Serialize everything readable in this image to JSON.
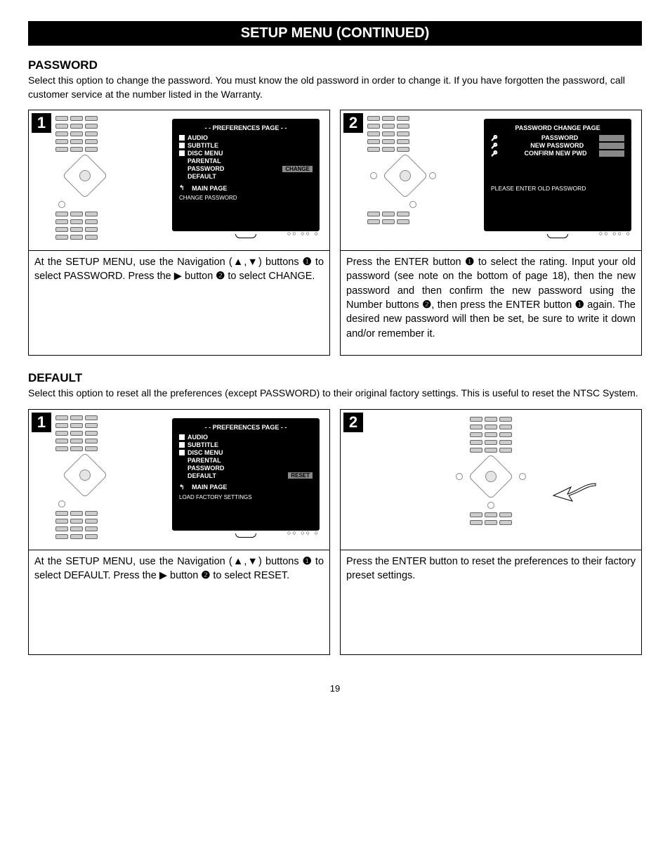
{
  "header": {
    "title": "SETUP MENU (CONTINUED)"
  },
  "sections": {
    "password": {
      "heading": "PASSWORD",
      "desc": "Select this option to change the password. You must know the old password in order to change it. If you have forgotten the password, call customer service at the number listed in the Warranty.",
      "step1": {
        "num": "1",
        "tv": {
          "title": "- - PREFERENCES PAGE - -",
          "items": [
            "AUDIO",
            "SUBTITLE",
            "DISC MENU",
            "PARENTAL",
            "PASSWORD",
            "DEFAULT"
          ],
          "highlight_on": "PASSWORD",
          "highlight": "CHANGE",
          "return": "MAIN PAGE",
          "footer": "CHANGE PASSWORD"
        },
        "caption_a": "At the SETUP MENU, use the Navigation (",
        "caption_b": ") buttons ",
        "caption_c": " to select PASSWORD. Press the ",
        "caption_d": " button ",
        "caption_e": " to select CHANGE."
      },
      "step2": {
        "num": "2",
        "tv": {
          "title": "PASSWORD CHANGE PAGE",
          "rows": [
            "PASSWORD",
            "NEW PASSWORD",
            "CONFIRM NEW PWD"
          ],
          "msg": "PLEASE ENTER OLD PASSWORD"
        },
        "caption_a": "Press the ENTER button ",
        "caption_b": " to select the rating. Input your old password (see note on the bottom of page 18), then the new password and then confirm the new password using the Number buttons ",
        "caption_c": ", then press the ENTER button ",
        "caption_d": " again. The desired new password will then be set, be sure to write it down and/or remember it."
      }
    },
    "default": {
      "heading": "DEFAULT",
      "desc": "Select this option to reset all the preferences (except PASSWORD) to their original factory settings. This is useful to reset the NTSC System.",
      "step1": {
        "num": "1",
        "tv": {
          "title": "- - PREFERENCES PAGE - -",
          "items": [
            "AUDIO",
            "SUBTITLE",
            "DISC MENU",
            "PARENTAL",
            "PASSWORD",
            "DEFAULT"
          ],
          "highlight_on": "DEFAULT",
          "highlight": "RESET",
          "return": "MAIN PAGE",
          "footer": "LOAD FACTORY SETTINGS"
        },
        "caption_a": "At the SETUP MENU, use the Navigation (",
        "caption_b": ") buttons ",
        "caption_c": " to select DEFAULT. Press the ",
        "caption_d": " button ",
        "caption_e": " to select RESET."
      },
      "step2": {
        "num": "2",
        "caption": "Press the ENTER button to reset the preferences to their factory preset settings."
      }
    }
  },
  "refs": {
    "one": "❶",
    "two": "❷"
  },
  "glyphs": {
    "up": "▲",
    "down": "▼",
    "right": "▶",
    "left_return": "↰"
  },
  "page_number": "19"
}
